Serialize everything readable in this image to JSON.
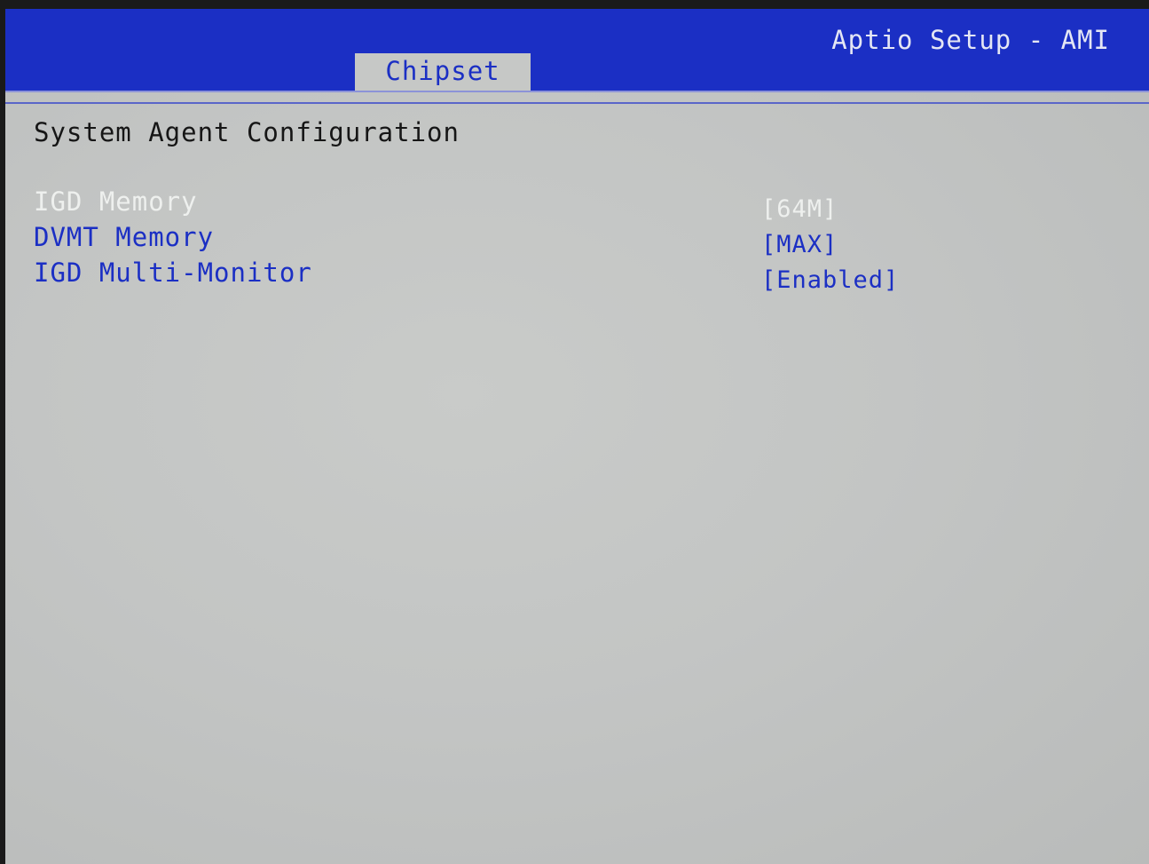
{
  "header": {
    "app_title": "Aptio Setup - AMI",
    "active_tab": "Chipset"
  },
  "section": {
    "title": "System Agent Configuration"
  },
  "settings": [
    {
      "label": "IGD Memory",
      "value": "[64M]",
      "selected": true
    },
    {
      "label": "DVMT Memory",
      "value": "[MAX]",
      "selected": false
    },
    {
      "label": "IGD Multi-Monitor",
      "value": "[Enabled]",
      "selected": false
    }
  ],
  "colors": {
    "header_blue": "#1b2fc4",
    "background_gray": "#c6c8c6",
    "selected_text": "#eef0ee",
    "item_text": "#1b2fc4"
  }
}
